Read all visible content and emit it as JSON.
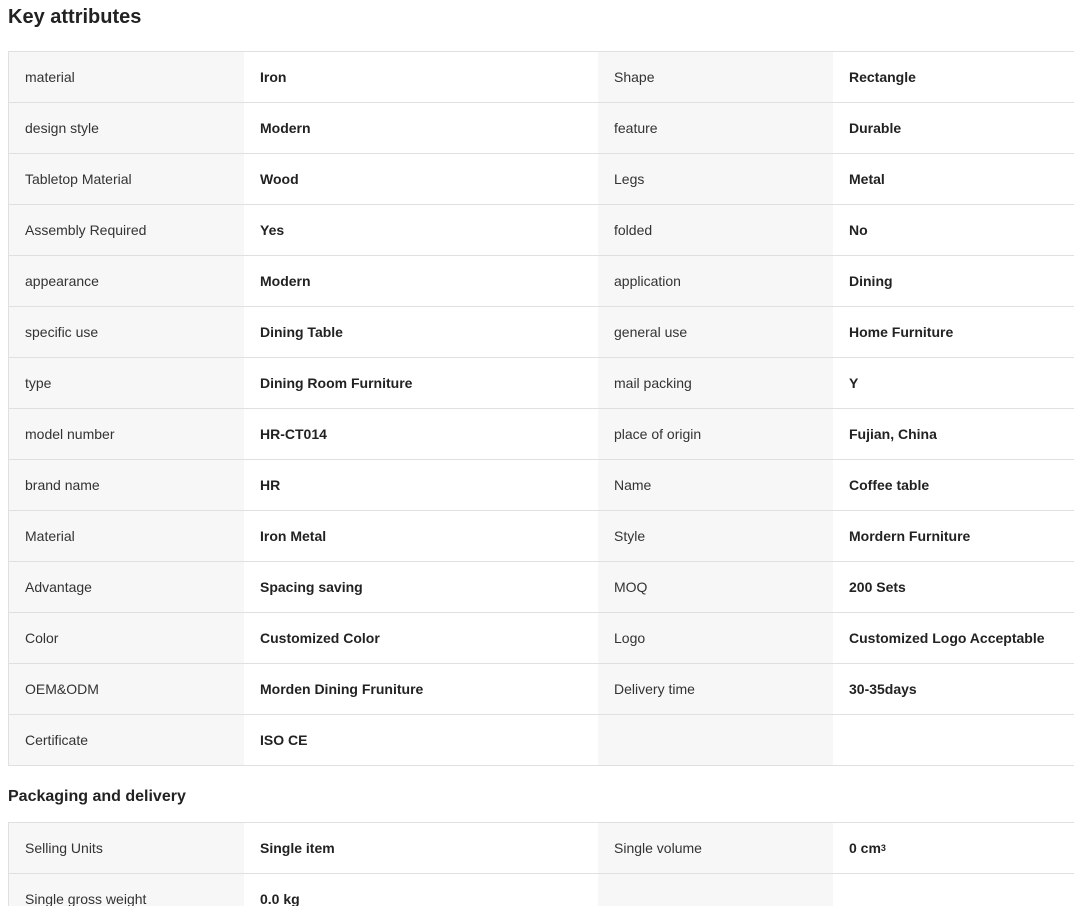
{
  "key_attributes": {
    "title": "Key attributes",
    "rows": [
      [
        {
          "label": "material",
          "value": "Iron"
        },
        {
          "label": "Shape",
          "value": "Rectangle"
        }
      ],
      [
        {
          "label": "design style",
          "value": "Modern"
        },
        {
          "label": "feature",
          "value": "Durable"
        }
      ],
      [
        {
          "label": "Tabletop Material",
          "value": "Wood"
        },
        {
          "label": "Legs",
          "value": "Metal"
        }
      ],
      [
        {
          "label": "Assembly Required",
          "value": "Yes"
        },
        {
          "label": "folded",
          "value": "No"
        }
      ],
      [
        {
          "label": "appearance",
          "value": "Modern"
        },
        {
          "label": "application",
          "value": "Dining"
        }
      ],
      [
        {
          "label": "specific use",
          "value": "Dining Table"
        },
        {
          "label": "general use",
          "value": "Home Furniture"
        }
      ],
      [
        {
          "label": "type",
          "value": "Dining Room Furniture"
        },
        {
          "label": "mail packing",
          "value": "Y"
        }
      ],
      [
        {
          "label": "model number",
          "value": "HR-CT014"
        },
        {
          "label": "place of origin",
          "value": "Fujian, China"
        }
      ],
      [
        {
          "label": "brand name",
          "value": "HR"
        },
        {
          "label": "Name",
          "value": "Coffee table"
        }
      ],
      [
        {
          "label": "Material",
          "value": "Iron Metal"
        },
        {
          "label": "Style",
          "value": "Mordern Furniture"
        }
      ],
      [
        {
          "label": "Advantage",
          "value": "Spacing saving"
        },
        {
          "label": "MOQ",
          "value": "200 Sets"
        }
      ],
      [
        {
          "label": "Color",
          "value": "Customized Color"
        },
        {
          "label": "Logo",
          "value": "Customized Logo Acceptable"
        }
      ],
      [
        {
          "label": "OEM&ODM",
          "value": "Morden Dining Fruniture"
        },
        {
          "label": "Delivery time",
          "value": "30-35days"
        }
      ],
      [
        {
          "label": "Certificate",
          "value": "ISO CE"
        },
        {
          "label": "",
          "value": ""
        }
      ]
    ]
  },
  "packaging": {
    "title": "Packaging and delivery",
    "rows": [
      [
        {
          "label": "Selling Units",
          "value": "Single item"
        },
        {
          "label": "Single volume",
          "value": "0 cm",
          "sup": "3"
        }
      ],
      [
        {
          "label": "Single gross weight",
          "value": "0.0 kg"
        },
        {
          "label": "",
          "value": ""
        }
      ]
    ]
  }
}
